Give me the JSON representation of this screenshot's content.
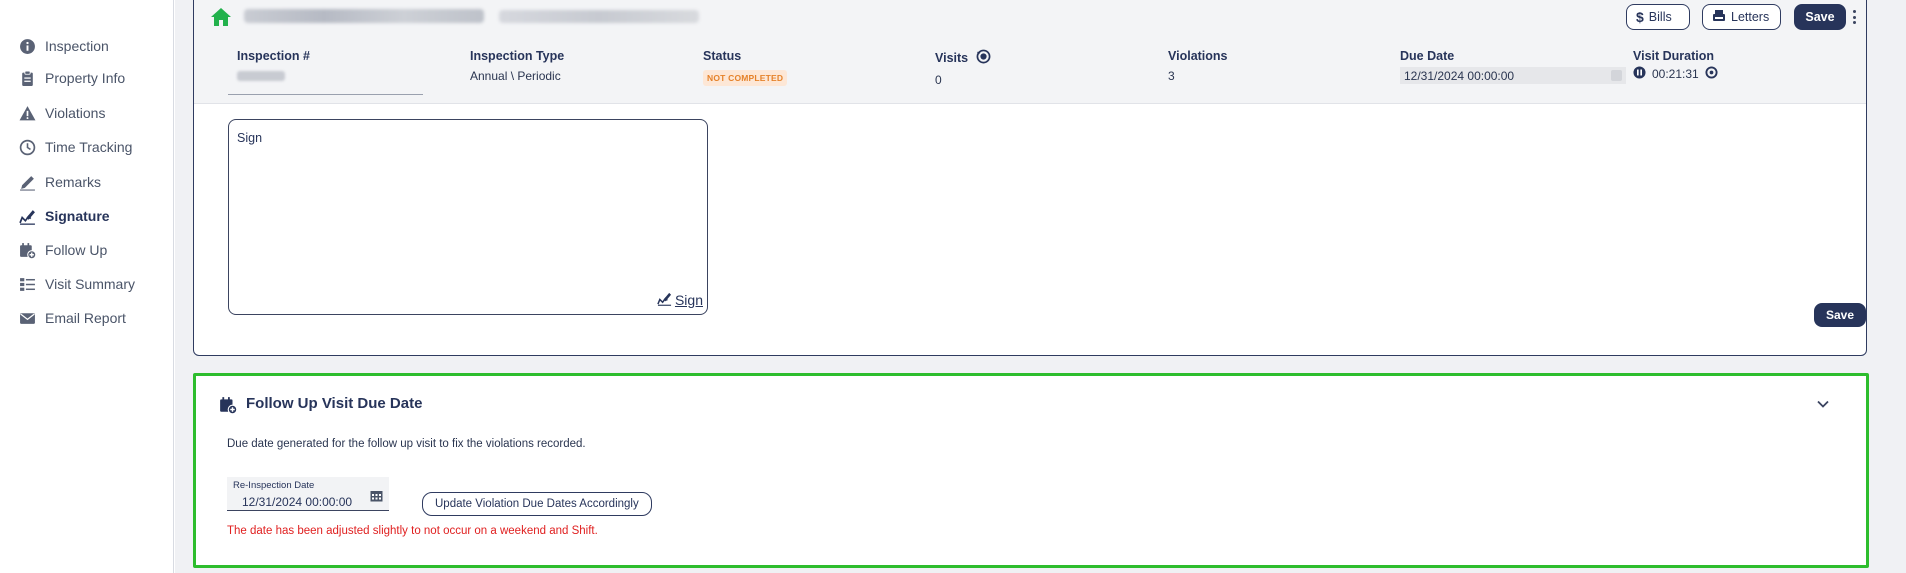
{
  "sidebar": {
    "items": [
      {
        "label": "Inspection",
        "icon": "info-icon"
      },
      {
        "label": "Property Info",
        "icon": "clipboard-icon"
      },
      {
        "label": "Violations",
        "icon": "warning-icon"
      },
      {
        "label": "Time Tracking",
        "icon": "clock-icon"
      },
      {
        "label": "Remarks",
        "icon": "pencil-icon"
      },
      {
        "label": "Signature",
        "icon": "signature-icon",
        "active": true
      },
      {
        "label": "Follow Up",
        "icon": "calendar-plus-icon"
      },
      {
        "label": "Visit Summary",
        "icon": "list-icon"
      },
      {
        "label": "Email Report",
        "icon": "envelope-icon"
      }
    ]
  },
  "header": {
    "buttons": {
      "bills": "Bills",
      "letters": "Letters",
      "save": "Save"
    },
    "columns": {
      "inspection_no": {
        "label": "Inspection #"
      },
      "inspection_type": {
        "label": "Inspection Type",
        "value": "Annual \\ Periodic"
      },
      "status": {
        "label": "Status",
        "value": "NOT COMPLETED"
      },
      "visits": {
        "label": "Visits",
        "value": "0"
      },
      "violations": {
        "label": "Violations",
        "value": "3"
      },
      "due_date": {
        "label": "Due Date",
        "value": "12/31/2024 00:00:00"
      },
      "visit_duration": {
        "label": "Visit Duration",
        "value": "00:21:31"
      }
    }
  },
  "signature": {
    "box_text": "Sign",
    "sign_link": "Sign",
    "save_label": "Save"
  },
  "follow_up": {
    "title": "Follow Up Visit Due Date",
    "description": "Due date generated for the follow up visit to fix the violations recorded.",
    "reinspection_label": "Re-Inspection Date",
    "reinspection_value": "12/31/2024 00:00:00",
    "update_button": "Update Violation Due Dates Accordingly",
    "warning": "The date has been adjusted slightly to not occur on a weekend and Shift."
  },
  "colors": {
    "navy": "#27345a",
    "highlight_green": "#2dbd2d",
    "home_green": "#22b14c",
    "warning_red": "#e02020",
    "badge_orange": "#e5822a"
  }
}
